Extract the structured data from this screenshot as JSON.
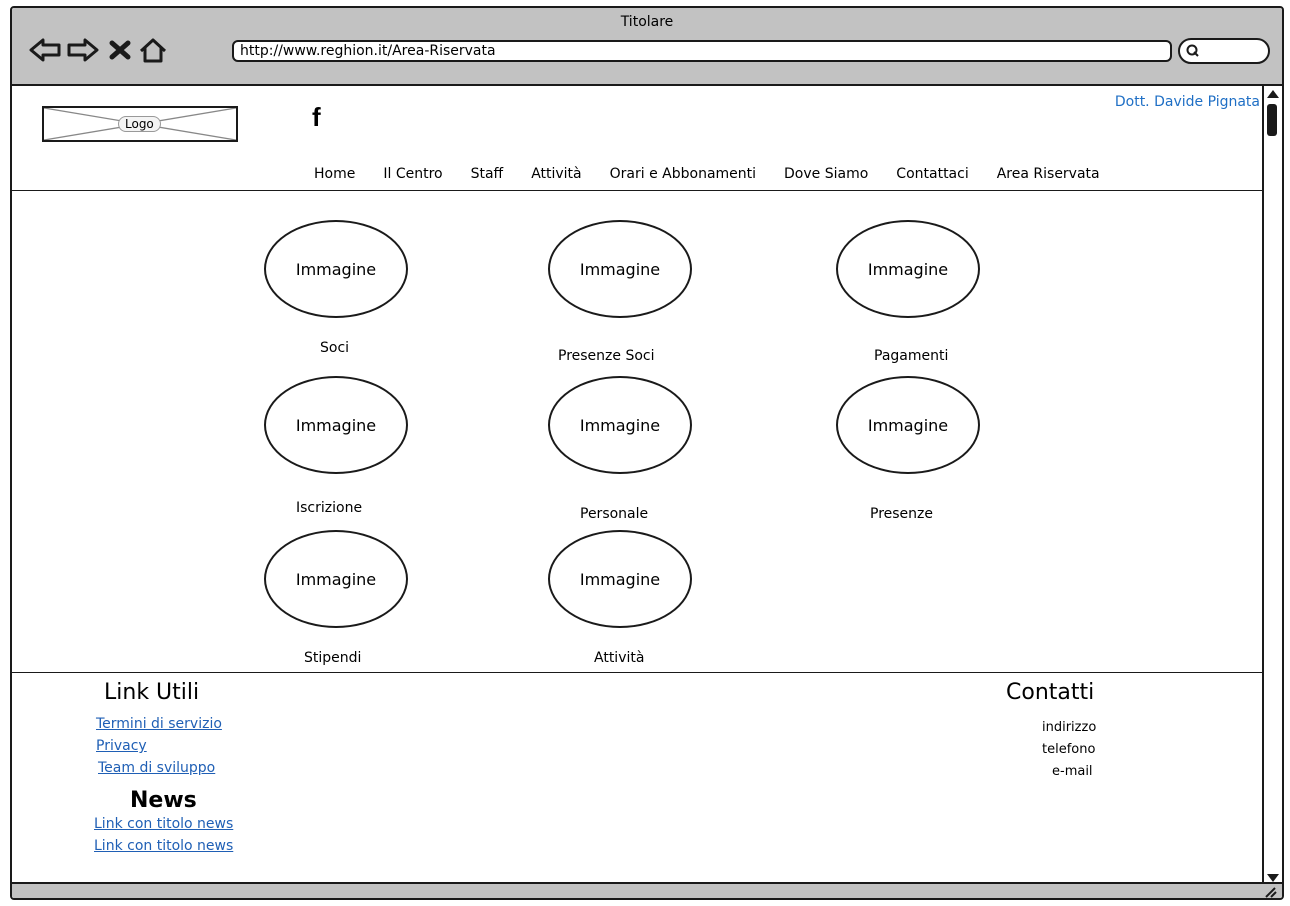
{
  "window": {
    "title": "Titolare"
  },
  "toolbar": {
    "url": "http://www.reghion.it/Area-Riservata",
    "back_icon": "back-arrow-icon",
    "forward_icon": "forward-arrow-icon",
    "stop_icon": "close-icon",
    "home_icon": "home-icon",
    "search_icon": "search-icon"
  },
  "header": {
    "user_name": "Dott. Davide Pignata",
    "logo_label": "Logo",
    "social_icon": "facebook-icon",
    "nav": [
      "Home",
      "Il Centro",
      "Staff",
      "Attività",
      "Orari e Abbonamenti",
      "Dove Siamo",
      "Contattaci",
      "Area Riservata"
    ]
  },
  "tiles": [
    {
      "image": "Immagine",
      "label": "Soci"
    },
    {
      "image": "Immagine",
      "label": "Presenze Soci"
    },
    {
      "image": "Immagine",
      "label": "Pagamenti"
    },
    {
      "image": "Immagine",
      "label": "Iscrizione"
    },
    {
      "image": "Immagine",
      "label": "Personale"
    },
    {
      "image": "Immagine",
      "label": "Presenze"
    },
    {
      "image": "Immagine",
      "label": "Stipendi"
    },
    {
      "image": "Immagine",
      "label": "Attività"
    }
  ],
  "footer": {
    "links_heading": "Link Utili",
    "links": [
      "Termini di servizio",
      "Privacy",
      "Team di sviluppo"
    ],
    "news_heading": "News",
    "news": [
      "Link con titolo news",
      "Link con titolo news"
    ],
    "contacts_heading": "Contatti",
    "contacts": [
      "indirizzo",
      "telefono",
      "e-mail"
    ]
  },
  "colors": {
    "chrome": "#c2c2c2",
    "link": "#1f5fb5",
    "user": "#1f6fc5"
  }
}
